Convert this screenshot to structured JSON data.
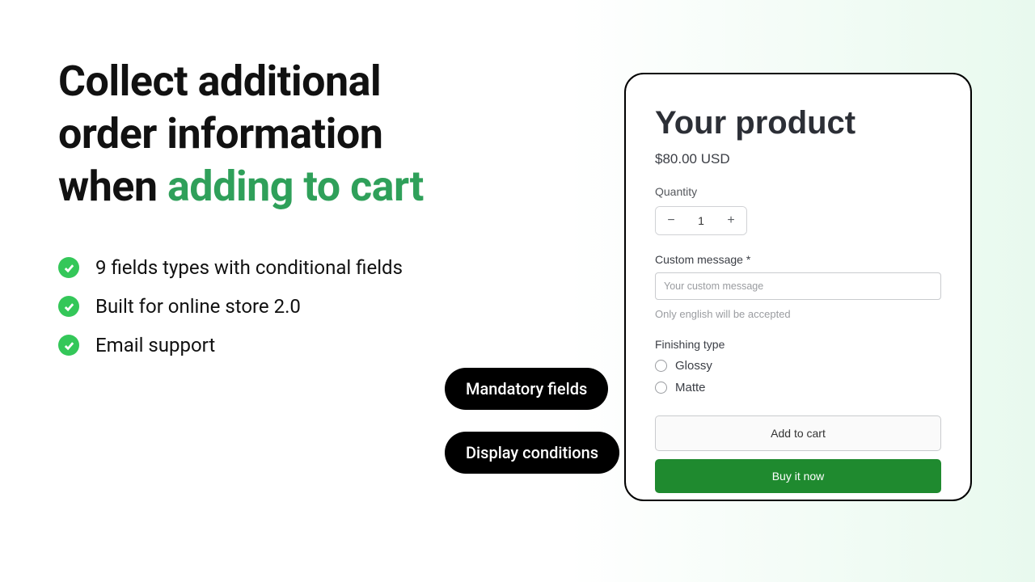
{
  "heading": {
    "line1": "Collect additional",
    "line2": "order information",
    "line3_prefix": "when ",
    "line3_accent": "adding to cart"
  },
  "features": [
    "9 fields types with conditional fields",
    "Built for online store 2.0",
    "Email support"
  ],
  "pills": {
    "mandatory": "Mandatory fields",
    "display": "Display conditions"
  },
  "product": {
    "title": "Your product",
    "price": "$80.00 USD",
    "quantity_label": "Quantity",
    "quantity_value": "1",
    "custom_label": "Custom message *",
    "custom_placeholder": "Your custom message",
    "custom_hint": "Only english will be accepted",
    "finishing_label": "Finishing type",
    "finishing_options": [
      "Glossy",
      "Matte"
    ],
    "add_to_cart": "Add to cart",
    "buy_now": "Buy it now"
  }
}
